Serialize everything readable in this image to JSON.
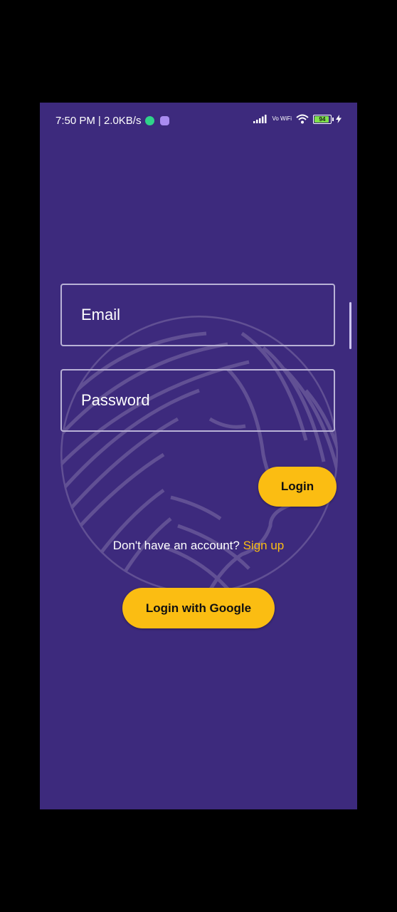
{
  "status_bar": {
    "time": "7:50 PM",
    "speed": "| 2.0KB/s",
    "network": "Vo WiFi",
    "battery": "94"
  },
  "form": {
    "email_placeholder": "Email",
    "password_placeholder": "Password",
    "login_label": "Login",
    "signup_prompt": "Don't have an account?",
    "signup_link": "Sign up",
    "google_label": "Login with Google"
  },
  "colors": {
    "background": "#3d2a7d",
    "accent": "#fbbd12",
    "field_border": "#b9b2d6"
  },
  "icons": [
    "signal-icon",
    "wifi-icon",
    "battery-icon",
    "charging-icon",
    "app-notification-icon",
    "brand-logo-watermark"
  ]
}
